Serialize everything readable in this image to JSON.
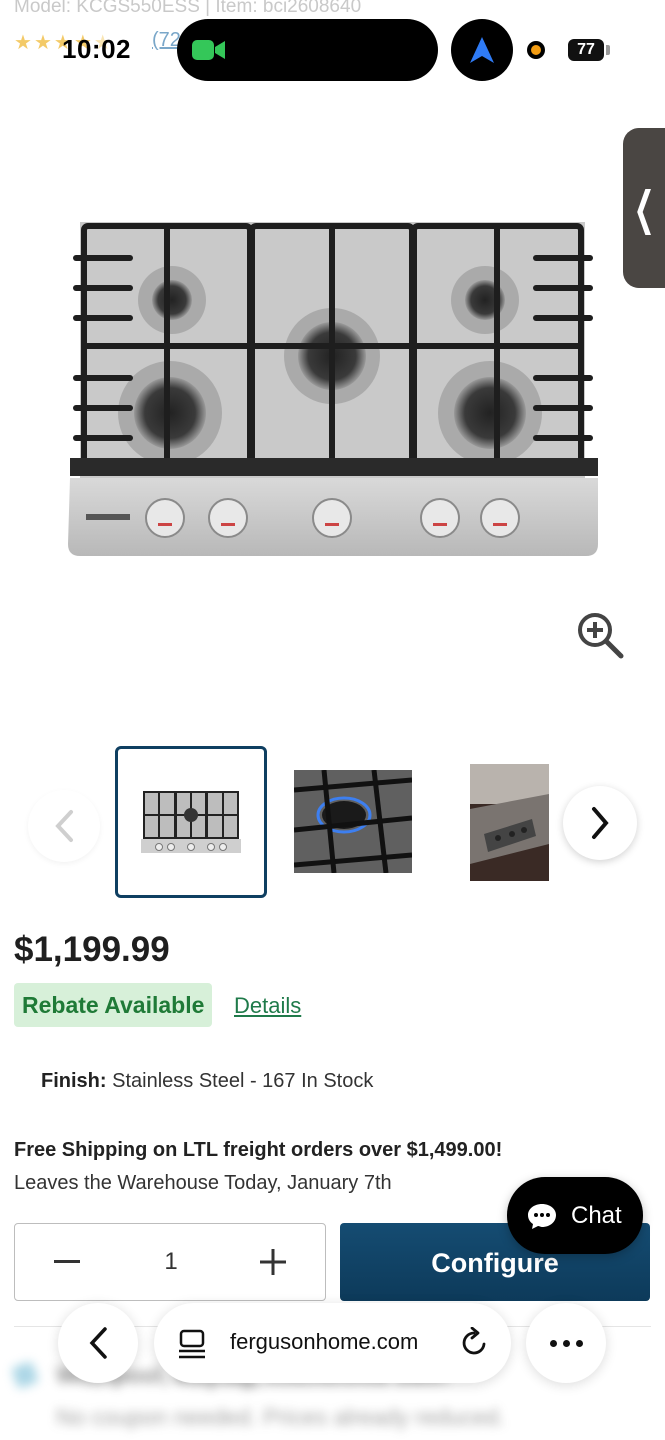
{
  "header": {
    "model_line": "Model: KCGS550ESS | Item: bci2608640",
    "rating_stars": 4.5,
    "review_count_text": "(72"
  },
  "status_bar": {
    "time": "10:02",
    "battery": "77"
  },
  "price": "$1,199.99",
  "rebate": {
    "badge": "Rebate Available",
    "details_link": "Details"
  },
  "finish": {
    "label": "Finish:",
    "value": "Stainless Steel - 167 In Stock"
  },
  "shipping": {
    "title": "Free Shipping on LTL freight orders over $1,499.00!",
    "subtitle": "Leaves the Warehouse Today, January 7th"
  },
  "quantity": {
    "value": "1"
  },
  "buttons": {
    "configure": "Configure",
    "chat": "Chat"
  },
  "promo": {
    "line1": "Whirlpool, Maytag, KitchenAid Sale!",
    "line2": "No coupon needed. Prices already reduced."
  },
  "browser": {
    "url": "fergusonhome.com"
  },
  "colors": {
    "accent": "#0f3f61",
    "rebate_bg": "#d7f0d9",
    "rebate_text": "#1f7a37",
    "link": "#1f7a4a"
  },
  "icons": [
    "video-camera-icon",
    "navigation-arrow-icon",
    "chevron-left-icon",
    "zoom-in-icon",
    "chevron-right-icon",
    "minus-icon",
    "plus-icon",
    "chat-bubble-icon",
    "tabs-icon",
    "reload-icon",
    "more-icon"
  ]
}
